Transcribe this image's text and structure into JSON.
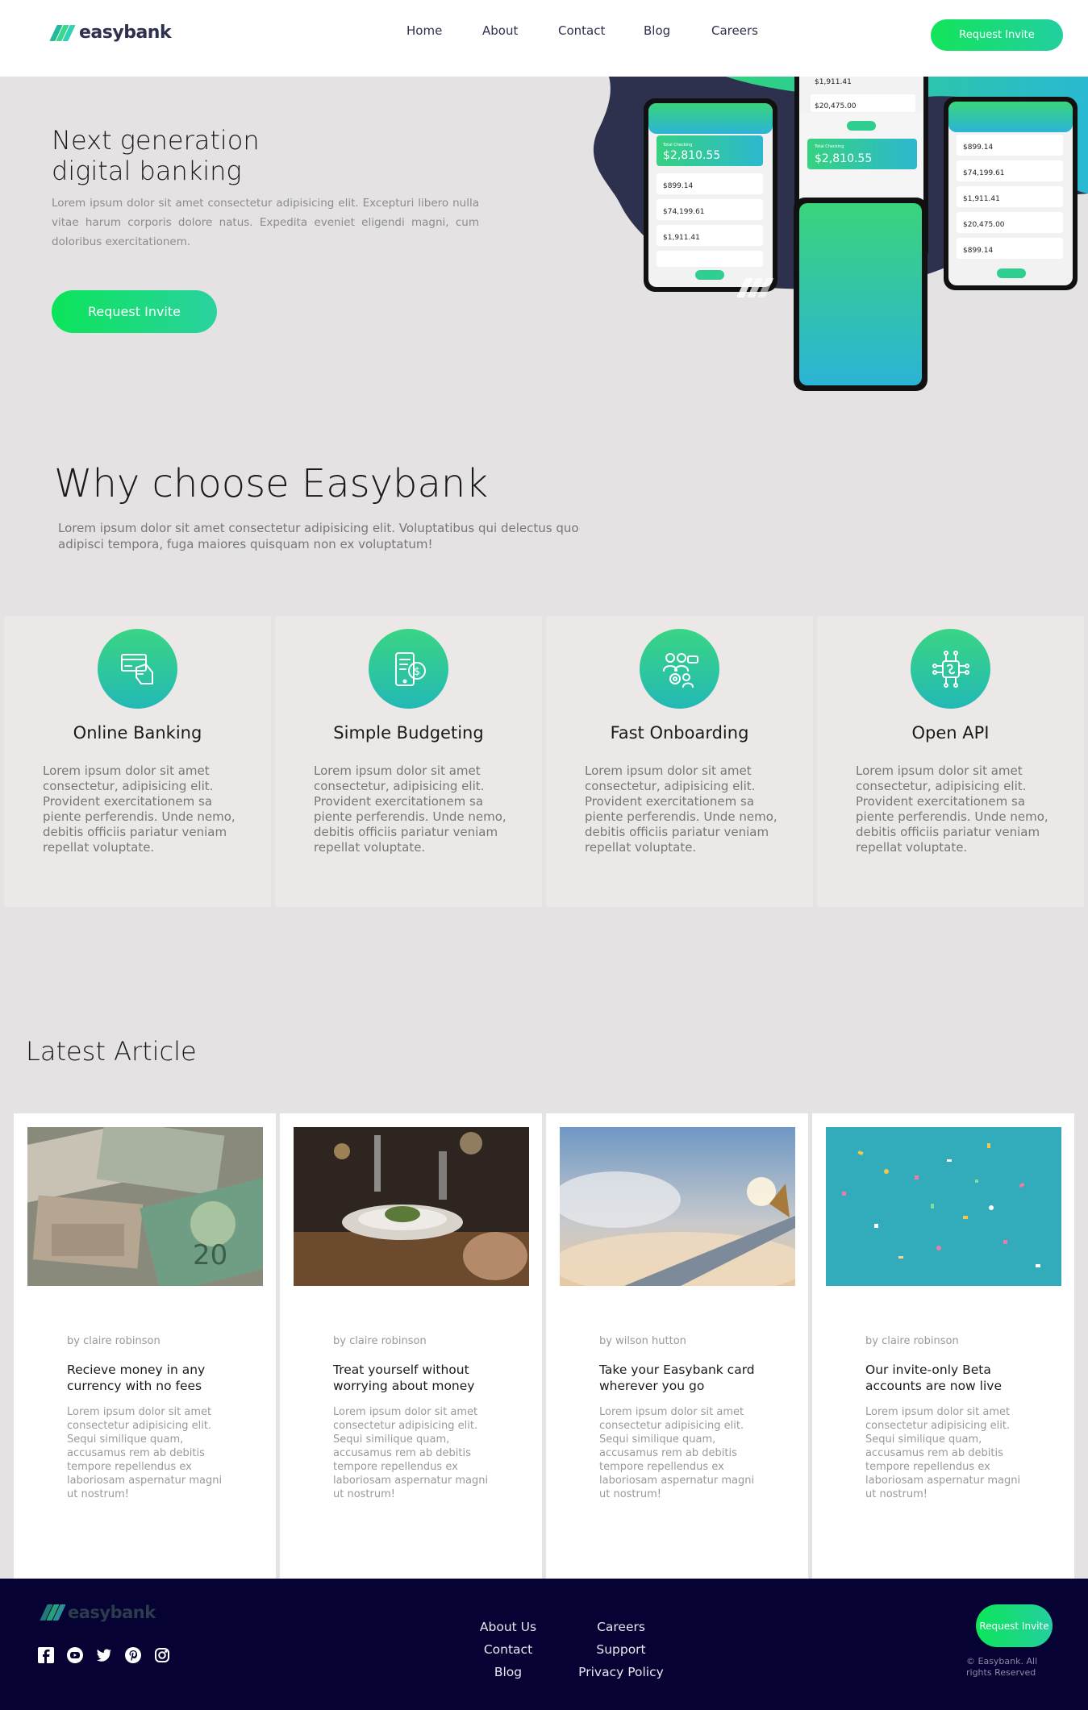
{
  "header": {
    "brand": "easybank",
    "nav": [
      "Home",
      "About",
      "Contact",
      "Blog",
      "Careers"
    ],
    "cta_label": "Request Invite"
  },
  "hero": {
    "title_line1": "Next generation",
    "title_line2": "digital banking",
    "description": "Lorem ipsum dolor sit amet consectetur adipisicing elit. Excepturi libero nulla vitae harum corporis dolore natus. Expedita eveniet eligendi magni, cum doloribus exercitationem.",
    "cta_label": "Request Invite",
    "phones": {
      "total_checking_label": "Total Checking",
      "total_checking": "$2,810.55",
      "accounts": [
        "$899.14",
        "$74,199.61",
        "$1,911.41",
        "$20,475.00"
      ]
    }
  },
  "why": {
    "title": "Why choose Easybank",
    "description": "Lorem ipsum dolor sit amet consectetur adipisicing elit. Voluptatibus qui delectus quo adipisci tempora, fuga maiores quisquam non ex voluptatum!",
    "features": [
      {
        "title": "Online Banking",
        "icon": "online-banking-icon",
        "text": "Lorem ipsum dolor sit amet consectetur, adipisicing elit. Provident exercitationem sa piente perferendis. Unde nemo, debitis officiis pariatur veniam repellat voluptate."
      },
      {
        "title": "Simple Budgeting",
        "icon": "budgeting-icon",
        "text": "Lorem ipsum dolor sit amet consectetur, adipisicing elit. Provident exercitationem sa piente perferendis. Unde nemo, debitis officiis pariatur veniam repellat voluptate."
      },
      {
        "title": "Fast Onboarding",
        "icon": "onboarding-icon",
        "text": "Lorem ipsum dolor sit amet consectetur, adipisicing elit. Provident exercitationem sa piente perferendis. Unde nemo, debitis officiis pariatur veniam repellat voluptate."
      },
      {
        "title": "Open API",
        "icon": "api-chip-icon",
        "text": "Lorem ipsum dolor sit amet consectetur, adipisicing elit. Provident exercitationem sa piente perferendis. Unde nemo, debitis officiis pariatur veniam repellat voluptate."
      }
    ]
  },
  "articles": {
    "title": "Latest Article",
    "items": [
      {
        "author": "by claire robinson",
        "title": "Recieve money in any currency with no fees",
        "text": "Lorem ipsum dolor sit amet consectetur adipisicing elit. Sequi similique quam, accusamus rem ab debitis tempore repellendus ex laboriosam aspernatur magni ut nostrum!",
        "image": "currency-photo"
      },
      {
        "author": "by claire robinson",
        "title": "Treat yourself without worrying about money",
        "text": "Lorem ipsum dolor sit amet consectetur adipisicing elit. Sequi similique quam, accusamus rem ab debitis tempore repellendus ex laboriosam aspernatur magni ut nostrum!",
        "image": "restaurant-photo"
      },
      {
        "author": "by wilson hutton",
        "title": "Take your Easybank card wherever you go",
        "text": "Lorem ipsum dolor sit amet consectetur adipisicing elit. Sequi similique quam, accusamus rem ab debitis tempore repellendus ex laboriosam aspernatur magni ut nostrum!",
        "image": "plane-photo"
      },
      {
        "author": "by claire robinson",
        "title": "Our invite-only Beta accounts are now live",
        "text": "Lorem ipsum dolor sit amet consectetur adipisicing elit. Sequi similique quam, accusamus rem ab debitis tempore repellendus ex laboriosam aspernatur magni ut nostrum!",
        "image": "confetti-photo"
      }
    ]
  },
  "footer": {
    "brand": "easybank",
    "socials": [
      "facebook-icon",
      "youtube-icon",
      "twitter-icon",
      "pinterest-icon",
      "instagram-icon"
    ],
    "col1": [
      "About Us",
      "Contact",
      "Blog"
    ],
    "col2": [
      "Careers",
      "Support",
      "Privacy Policy"
    ],
    "cta_label": "Request Invite",
    "copyright": "© Easybank. All rights Reserved"
  },
  "colors": {
    "accent_green": "#12e45a",
    "accent_cyan": "#22cfa0",
    "dark_navy": "#2d314d",
    "footer_bg": "#060233",
    "page_bg": "#e4e2e3"
  }
}
